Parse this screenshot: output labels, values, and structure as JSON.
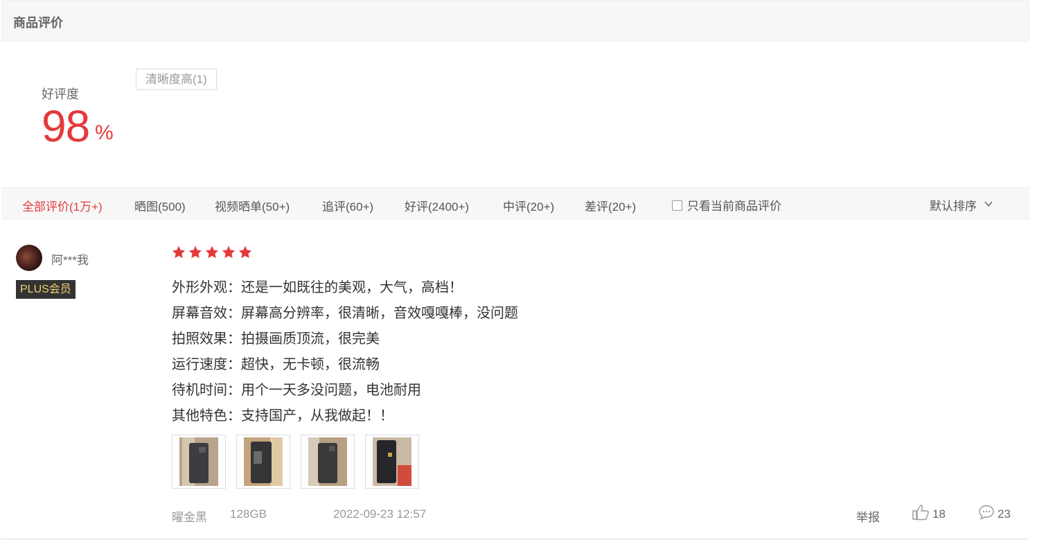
{
  "header": {
    "title": "商品评价"
  },
  "rating": {
    "label": "好评度",
    "value": "98",
    "unit": "%"
  },
  "tags": [
    {
      "label": "清晰度高(1)"
    }
  ],
  "filters": {
    "tabs": [
      {
        "label": "全部评价(1万+)",
        "active": true
      },
      {
        "label": "晒图(500)"
      },
      {
        "label": "视频晒单(50+)"
      },
      {
        "label": "追评(60+)"
      },
      {
        "label": "好评(2400+)"
      },
      {
        "label": "中评(20+)"
      },
      {
        "label": "差评(20+)"
      }
    ],
    "only_current_label": "只看当前商品评价",
    "sort_label": "默认排序"
  },
  "review": {
    "user": {
      "name": "阿***我",
      "badge": "PLUS会员"
    },
    "stars": 5,
    "lines": [
      "外形外观：还是一如既往的美观，大气，高档！",
      "屏幕音效：屏幕高分辨率，很清晰，音效嘎嘎棒，没问题",
      "拍照效果：拍摄画质顶流，很完美",
      "运行速度：超快，无卡顿，很流畅",
      "待机时间：用个一天多没问题，电池耐用",
      "其他特色：支持国产，从我做起！！"
    ],
    "photos": 4,
    "color": "曜金黑",
    "storage": "128GB",
    "date": "2022-09-23 12:57",
    "report_label": "举报",
    "likes": "18",
    "comments": "23"
  },
  "colors": {
    "accent": "#e4393c",
    "badge_bg": "#333333",
    "badge_text": "#f5d271"
  },
  "icons": {
    "like": "thumbs-up-icon",
    "comment": "comment-bubble-icon",
    "sort": "chevron-down-icon",
    "star": "star-icon"
  }
}
